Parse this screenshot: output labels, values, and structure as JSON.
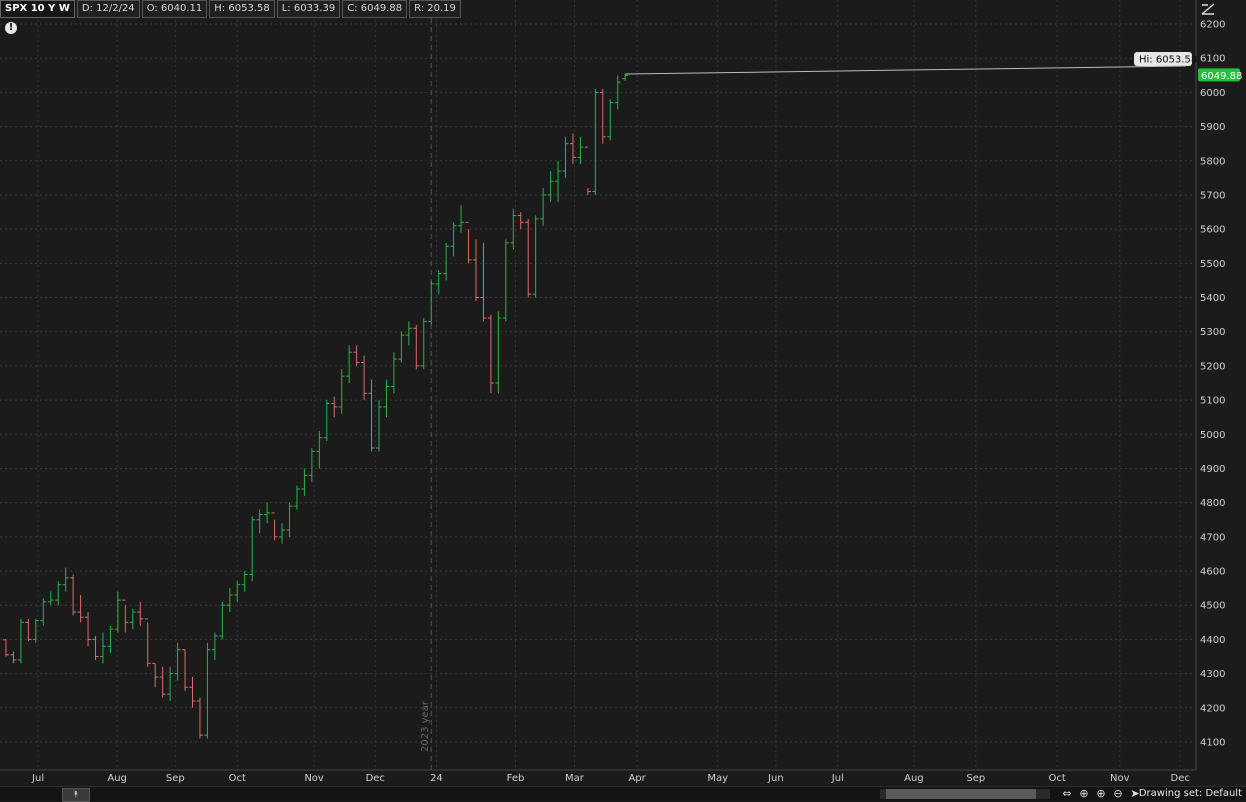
{
  "header": {
    "symbol": "SPX 10 Y W",
    "date": "D: 12/2/24",
    "open": "O: 6040.11",
    "high": "H: 6053.58",
    "low": "L: 6033.39",
    "close": "C: 6049.88",
    "range": "R: 20.19"
  },
  "warning_icon_glyph": "!",
  "bottom": {
    "collapse_glyph": "⯭",
    "drawing_set": "Drawing set: Default"
  },
  "colors": {
    "up": "#2bb34a",
    "down": "#e06a6a",
    "price_tag": "#22c03c"
  },
  "chart_data": {
    "type": "ohlc",
    "ylim": [
      4040,
      6230
    ],
    "y_ticks": [
      4100,
      4200,
      4300,
      4400,
      4500,
      4600,
      4700,
      4800,
      4900,
      5000,
      5100,
      5200,
      5300,
      5400,
      5500,
      5600,
      5700,
      5800,
      5900,
      6000,
      6100,
      6200
    ],
    "x_labels": [
      {
        "label": "Jul",
        "bar": 4.3
      },
      {
        "label": "Aug",
        "bar": 14.9
      },
      {
        "label": "Sep",
        "bar": 22.7
      },
      {
        "label": "Oct",
        "bar": 31
      },
      {
        "label": "Nov",
        "bar": 41.3
      },
      {
        "label": "Dec",
        "bar": 49.5
      },
      {
        "label": "24",
        "bar": 57.7
      },
      {
        "label": "Feb",
        "bar": 68.3
      },
      {
        "label": "Mar",
        "bar": 76.2
      },
      {
        "label": "Apr",
        "bar": 84.6
      },
      {
        "label": "May",
        "bar": 95.4
      },
      {
        "label": "Jun",
        "bar": 103.2
      },
      {
        "label": "Jul",
        "bar": 111.5
      },
      {
        "label": "Aug",
        "bar": 121.7
      },
      {
        "label": "Sep",
        "bar": 130
      },
      {
        "label": "Oct",
        "bar": 140.9
      },
      {
        "label": "Nov",
        "bar": 149.3
      },
      {
        "label": "Dec",
        "bar": 157.4
      }
    ],
    "year_marker": {
      "label": "2023 year",
      "bar": 57
    },
    "hi_label": "Hi: 6053.58",
    "last_price": "6049.88",
    "bars": [
      [
        4399,
        4400,
        4350,
        4355
      ],
      [
        4355,
        4365,
        4330,
        4340
      ],
      [
        4340,
        4460,
        4330,
        4450
      ],
      [
        4450,
        4460,
        4395,
        4400
      ],
      [
        4400,
        4460,
        4390,
        4455
      ],
      [
        4455,
        4520,
        4440,
        4510
      ],
      [
        4510,
        4540,
        4500,
        4515
      ],
      [
        4515,
        4570,
        4500,
        4560
      ],
      [
        4560,
        4610,
        4540,
        4580
      ],
      [
        4580,
        4590,
        4470,
        4480
      ],
      [
        4480,
        4530,
        4450,
        4465
      ],
      [
        4465,
        4480,
        4380,
        4400
      ],
      [
        4400,
        4410,
        4340,
        4350
      ],
      [
        4350,
        4420,
        4330,
        4380
      ],
      [
        4380,
        4440,
        4360,
        4430
      ],
      [
        4430,
        4540,
        4420,
        4515
      ],
      [
        4515,
        4500,
        4420,
        4450
      ],
      [
        4450,
        4490,
        4430,
        4480
      ],
      [
        4480,
        4510,
        4440,
        4460
      ],
      [
        4460,
        4450,
        4320,
        4330
      ],
      [
        4330,
        4330,
        4260,
        4290
      ],
      [
        4290,
        4320,
        4230,
        4240
      ],
      [
        4240,
        4320,
        4220,
        4300
      ],
      [
        4300,
        4390,
        4280,
        4370
      ],
      [
        4370,
        4370,
        4250,
        4260
      ],
      [
        4260,
        4290,
        4200,
        4220
      ],
      [
        4220,
        4230,
        4110,
        4120
      ],
      [
        4120,
        4390,
        4110,
        4370
      ],
      [
        4370,
        4420,
        4340,
        4410
      ],
      [
        4410,
        4510,
        4400,
        4500
      ],
      [
        4500,
        4550,
        4480,
        4530
      ],
      [
        4530,
        4570,
        4510,
        4560
      ],
      [
        4560,
        4600,
        4540,
        4590
      ],
      [
        4590,
        4760,
        4570,
        4750
      ],
      [
        4750,
        4780,
        4710,
        4765
      ],
      [
        4765,
        4800,
        4740,
        4770
      ],
      [
        4770,
        4750,
        4690,
        4700
      ],
      [
        4700,
        4740,
        4680,
        4720
      ],
      [
        4720,
        4800,
        4700,
        4790
      ],
      [
        4790,
        4850,
        4780,
        4840
      ],
      [
        4840,
        4900,
        4820,
        4880
      ],
      [
        4880,
        4960,
        4860,
        4950
      ],
      [
        4950,
        5010,
        4900,
        4990
      ],
      [
        4990,
        5100,
        4980,
        5090
      ],
      [
        5090,
        5110,
        5050,
        5080
      ],
      [
        5080,
        5190,
        5060,
        5170
      ],
      [
        5170,
        5260,
        5150,
        5240
      ],
      [
        5240,
        5260,
        5200,
        5210
      ],
      [
        5210,
        5230,
        5100,
        5120
      ],
      [
        5120,
        5160,
        4950,
        4960
      ],
      [
        4960,
        5100,
        4950,
        5080
      ],
      [
        5080,
        5160,
        5050,
        5140
      ],
      [
        5140,
        5240,
        5120,
        5220
      ],
      [
        5220,
        5300,
        5210,
        5290
      ],
      [
        5290,
        5330,
        5260,
        5310
      ],
      [
        5310,
        5320,
        5190,
        5200
      ],
      [
        5200,
        5340,
        5190,
        5330
      ],
      [
        5330,
        5450,
        5320,
        5440
      ],
      [
        5440,
        5480,
        5410,
        5470
      ],
      [
        5470,
        5560,
        5450,
        5550
      ],
      [
        5550,
        5620,
        5520,
        5610
      ],
      [
        5610,
        5670,
        5590,
        5620
      ],
      [
        5620,
        5600,
        5500,
        5510
      ],
      [
        5510,
        5570,
        5390,
        5400
      ],
      [
        5400,
        5560,
        5330,
        5340
      ],
      [
        5340,
        5350,
        5120,
        5150
      ],
      [
        5150,
        5360,
        5120,
        5340
      ],
      [
        5340,
        5570,
        5330,
        5560
      ],
      [
        5560,
        5660,
        5540,
        5640
      ],
      [
        5640,
        5650,
        5600,
        5620
      ],
      [
        5620,
        5630,
        5400,
        5410
      ],
      [
        5410,
        5640,
        5400,
        5630
      ],
      [
        5630,
        5720,
        5610,
        5700
      ],
      [
        5700,
        5770,
        5680,
        5740
      ],
      [
        5740,
        5800,
        5680,
        5770
      ],
      [
        5770,
        5870,
        5750,
        5850
      ],
      [
        5850,
        5880,
        5790,
        5810
      ],
      [
        5810,
        5870,
        5790,
        5840
      ],
      [
        5840,
        5720,
        5700,
        5710
      ],
      [
        5710,
        6010,
        5700,
        6000
      ],
      [
        6000,
        6010,
        5850,
        5870
      ],
      [
        5870,
        5980,
        5860,
        5970
      ],
      [
        5970,
        6050,
        5950,
        6030
      ],
      [
        6040,
        6053.58,
        6033.39,
        6049.88
      ]
    ]
  }
}
